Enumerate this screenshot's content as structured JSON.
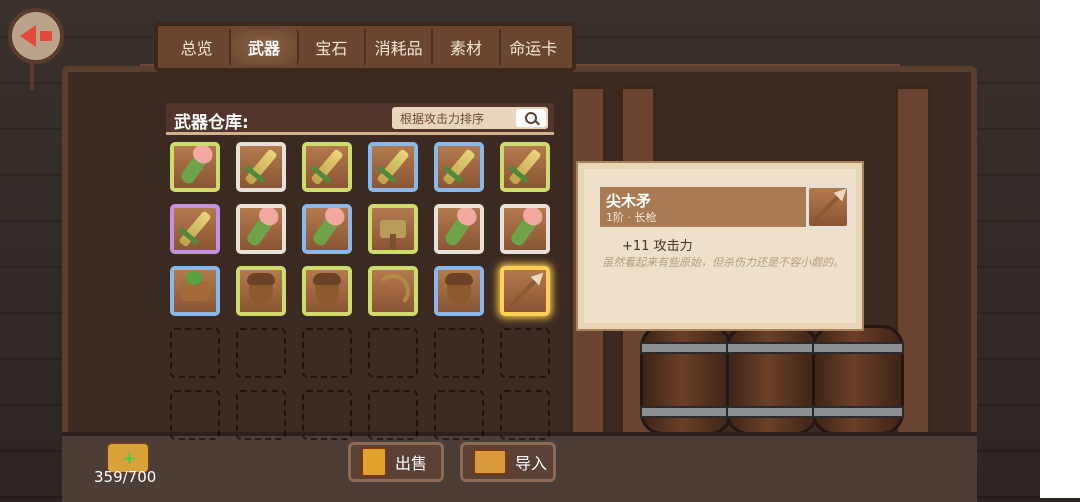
{
  "tabs": [
    {
      "label": "总览",
      "active": false
    },
    {
      "label": "武器",
      "active": true
    },
    {
      "label": "宝石",
      "active": false
    },
    {
      "label": "消耗品",
      "active": false
    },
    {
      "label": "素材",
      "active": false
    },
    {
      "label": "命运卡",
      "active": false
    }
  ],
  "warehouse": {
    "title": "武器仓库:",
    "sort_label": "根据攻击力排序"
  },
  "inventory": {
    "slots": [
      {
        "icon": "peach-club-icon",
        "rarity": "green"
      },
      {
        "icon": "sword-icon",
        "rarity": "white"
      },
      {
        "icon": "sword-icon",
        "rarity": "green"
      },
      {
        "icon": "sword-icon",
        "rarity": "blue"
      },
      {
        "icon": "sword-icon",
        "rarity": "blue"
      },
      {
        "icon": "sword-icon",
        "rarity": "green"
      },
      {
        "icon": "sword-icon",
        "rarity": "purple"
      },
      {
        "icon": "peach-club-icon",
        "rarity": "white"
      },
      {
        "icon": "peach-club-icon",
        "rarity": "blue"
      },
      {
        "icon": "hammer-icon",
        "rarity": "green"
      },
      {
        "icon": "peach-club-icon",
        "rarity": "white"
      },
      {
        "icon": "peach-club-icon",
        "rarity": "white"
      },
      {
        "icon": "log-cannon-icon",
        "rarity": "blue"
      },
      {
        "icon": "acorn-icon",
        "rarity": "green"
      },
      {
        "icon": "acorn-icon",
        "rarity": "green"
      },
      {
        "icon": "bow-icon",
        "rarity": "green"
      },
      {
        "icon": "acorn-icon",
        "rarity": "blue"
      },
      {
        "icon": "spear-icon",
        "rarity": "selected"
      }
    ],
    "empty_slots": 12,
    "capacity_text": "359/700"
  },
  "detail": {
    "name": "尖木矛",
    "type": "1阶 · 长枪",
    "stat": "+11  攻击力",
    "description": "虽然看起来有些原始，但杀伤力还是不容小觑的。",
    "icon": "spear-icon"
  },
  "buttons": {
    "sell_label": "出售",
    "import_label": "导入"
  },
  "colors": {
    "rarity_green": "#cddc6a",
    "rarity_blue": "#8bb8ea",
    "rarity_purple": "#c392e0",
    "rarity_white": "#e6e2da",
    "selected_glow": "#ffd257"
  }
}
